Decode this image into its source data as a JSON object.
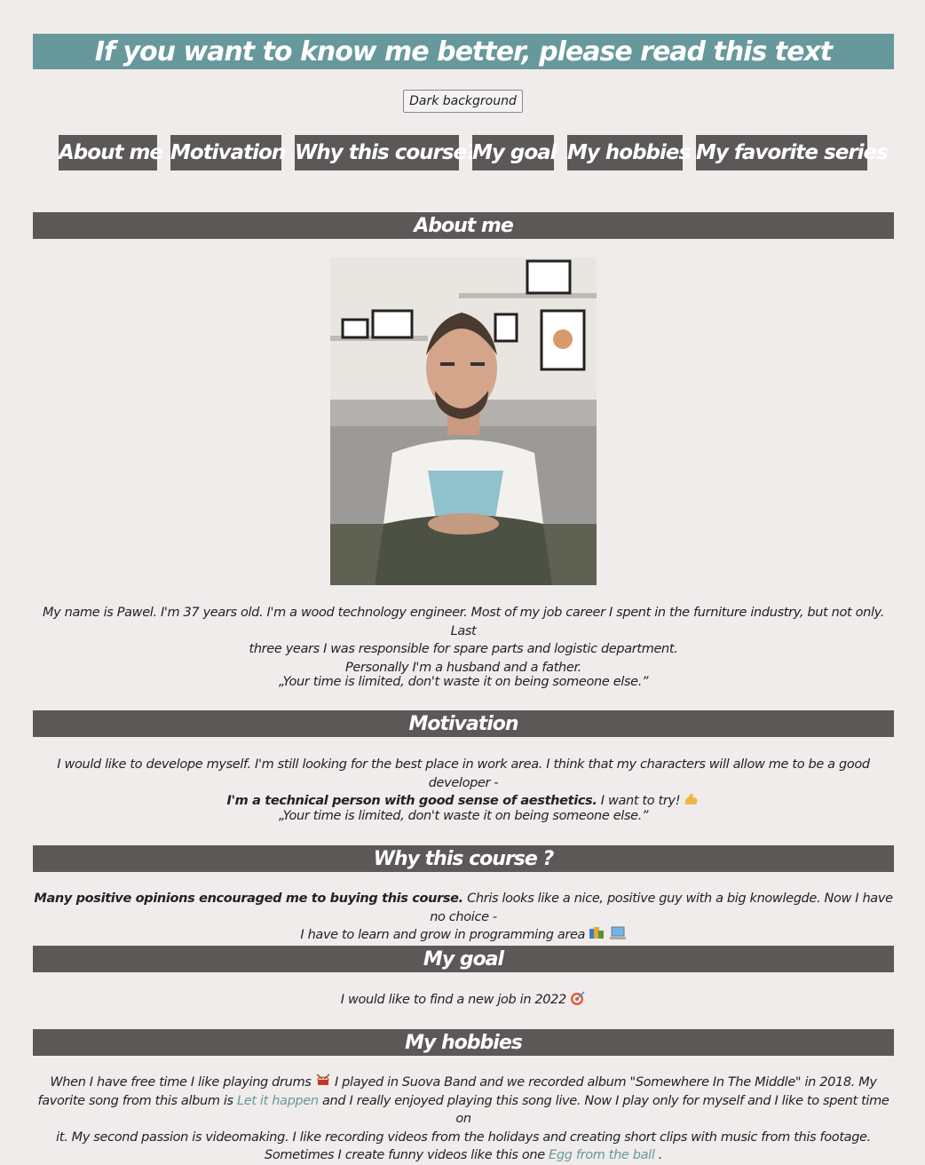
{
  "header": {
    "title": "If you want to know me better, please read this text"
  },
  "theme_button": {
    "label": "Dark background"
  },
  "nav": {
    "items": [
      "About me",
      "Motivation",
      "Why this course?",
      "My goal",
      "My hobbies",
      "My favorite series"
    ]
  },
  "sections": {
    "about": {
      "heading": "About me",
      "text1": "My name is Pawel. I'm 37 years old. I'm a wood technology engineer. Most of my job career I spent in the furniture industry, but not only. Last",
      "text2": "three years I was responsible for spare parts and logistic department.",
      "text3": "Personally I'm a husband and a father.",
      "quote": "„Your time is limited, don't waste it on being someone else.”"
    },
    "motivation": {
      "heading": "Motivation",
      "text1": "I would like to develope myself. I'm still looking for the best place in work area. I think that my characters will allow me to be a good developer -",
      "bold": "I'm a technical person with good sense of aesthetics.",
      "text2": " I want to try!",
      "quote": "„Your time is limited, don't waste it on being someone else.”"
    },
    "course": {
      "heading": "Why this course ?",
      "bold": "Many positive opinions encouraged me to buying this course.",
      "text1": " Chris looks like a nice, positive guy with a big knowlegde. Now I have no choice -",
      "text2": "I have to learn and grow in programming area"
    },
    "goal": {
      "heading": "My goal",
      "text": "I would like to find a new job in 2022"
    },
    "hobbies": {
      "heading": "My hobbies",
      "text1": "When I have free time I like playing drums",
      "text2": " I played in Suova Band and we recorded album \"Somewhere In The Middle\" in 2018. My",
      "text3": "favorite song from this album is ",
      "link1": "Let it happen",
      "text4": " and I really enjoyed playing this song live. Now I play only for myself and I like to spent time on",
      "text5": "it. My second passion is videomaking. I like recording videos from the holidays and creating short clips with music from this footage.",
      "text6": "Sometimes I create funny videos like this one ",
      "link2": "Egg from the ball",
      "text7": " ."
    }
  },
  "icons": {
    "flexed-biceps": "flexed-biceps-icon",
    "books": "books-icon",
    "laptop": "laptop-icon",
    "target": "target-icon",
    "drum": "drum-icon"
  },
  "colors": {
    "title_bar": "#67989c",
    "section_bar": "#5c5858",
    "background": "#efeceb",
    "link": "#67989c"
  }
}
